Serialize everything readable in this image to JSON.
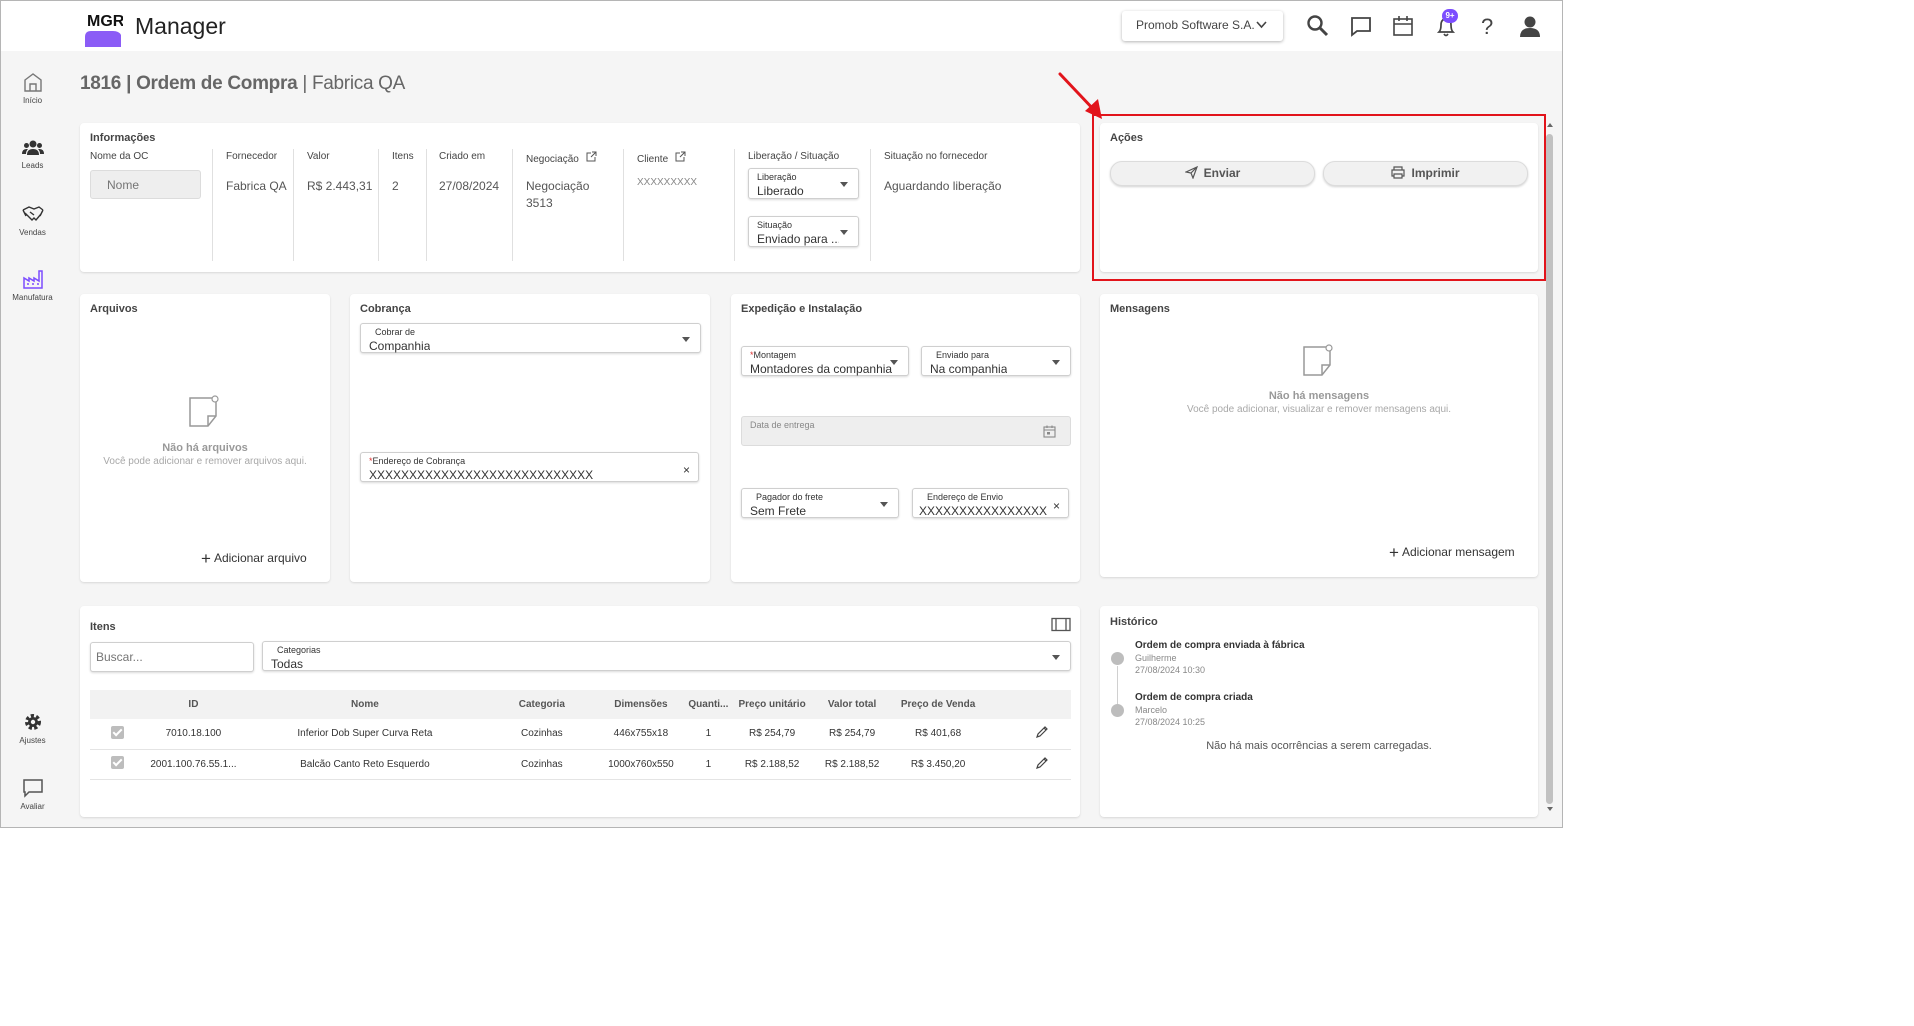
{
  "app": {
    "logo_text": "MGR",
    "title": "Manager"
  },
  "topbar": {
    "company": "Promob Software S.A.",
    "notification_badge": "9+"
  },
  "sidebar": {
    "items": [
      {
        "label": "Início",
        "icon": "home-icon"
      },
      {
        "label": "Leads",
        "icon": "people-icon"
      },
      {
        "label": "Vendas",
        "icon": "handshake-icon"
      },
      {
        "label": "Manufatura",
        "icon": "factory-icon"
      },
      {
        "label": "Ajustes",
        "icon": "gear-icon"
      },
      {
        "label": "Avaliar",
        "icon": "chat-icon"
      }
    ]
  },
  "page": {
    "number": "1816",
    "doc_type": "Ordem de Compra",
    "separator": "|",
    "subtitle": "Fabrica QA"
  },
  "info": {
    "title": "Informações",
    "oc_name_label": "Nome da OC",
    "oc_name_placeholder": "Nome",
    "fornecedor_label": "Fornecedor",
    "fornecedor": "Fabrica QA",
    "valor_label": "Valor",
    "valor": "R$ 2.443,31",
    "itens_label": "Itens",
    "itens": "2",
    "criado_label": "Criado em",
    "criado": "27/08/2024",
    "negociacao_label": "Negociação",
    "negociacao_l1": "Negociação",
    "negociacao_l2": "3513",
    "cliente_label": "Cliente",
    "cliente": "XXXXXXXXX",
    "liberacao_situacao_label": "Liberação / Situação",
    "liberacao_label": "Liberação",
    "liberacao": "Liberado",
    "situacao_label": "Situação",
    "situacao": "Enviado para ...",
    "situacao_fornecedor_label": "Situação no fornecedor",
    "situacao_fornecedor": "Aguardando liberação"
  },
  "acoes": {
    "title": "Ações",
    "send": "Enviar",
    "print": "Imprimir"
  },
  "arquivos": {
    "title": "Arquivos",
    "empty_title": "Não há arquivos",
    "empty_sub": "Você pode adicionar e remover arquivos aqui.",
    "add": "Adicionar arquivo"
  },
  "cobranca": {
    "title": "Cobrança",
    "cobrar_label": "Cobrar de",
    "cobrar": "Companhia",
    "endereco_label": "Endereço de Cobrança",
    "endereco": "XXXXXXXXXXXXXXXXXXXXXXXXXXXX"
  },
  "expedicao": {
    "title": "Expedição e Instalação",
    "montagem_label": "Montagem",
    "montagem": "Montadores da companhia",
    "enviado_label": "Enviado para",
    "enviado": "Na companhia",
    "data_label": "Data de entrega",
    "pagador_label": "Pagador do frete",
    "pagador": "Sem Frete",
    "envio_label": "Endereço de Envio",
    "envio": "XXXXXXXXXXXXXXXXX"
  },
  "mensagens": {
    "title": "Mensagens",
    "empty_title": "Não há mensagens",
    "empty_sub": "Você pode adicionar, visualizar e remover mensagens aqui.",
    "add": "Adicionar mensagem"
  },
  "itens": {
    "title": "Itens",
    "search_placeholder": "Buscar...",
    "categorias_label": "Categorias",
    "categorias": "Todas",
    "columns": [
      "ID",
      "Nome",
      "Categoria",
      "Dimensões",
      "Quanti...",
      "Preço unitário",
      "Valor total",
      "Preço de Venda"
    ],
    "rows": [
      {
        "id": "7010.18.100",
        "nome": "Inferior Dob Super Curva Reta",
        "categoria": "Cozinhas",
        "dimensoes": "446x755x18",
        "qtd": "1",
        "unit": "R$ 254,79",
        "total": "R$ 254,79",
        "venda": "R$ 401,68"
      },
      {
        "id": "2001.100.76.55.1...",
        "nome": "Balcão Canto Reto Esquerdo",
        "categoria": "Cozinhas",
        "dimensoes": "1000x760x550",
        "qtd": "1",
        "unit": "R$ 2.188,52",
        "total": "R$ 2.188,52",
        "venda": "R$ 3.450,20"
      }
    ]
  },
  "historico": {
    "title": "Histórico",
    "events": [
      {
        "title": "Ordem de compra enviada à fábrica",
        "user": "Guilherme",
        "date": "27/08/2024 10:30"
      },
      {
        "title": "Ordem de compra criada",
        "user": "Marcelo",
        "date": "27/08/2024 10:25"
      }
    ],
    "end_text": "Não há mais ocorrências a serem carregadas."
  },
  "colors": {
    "accent": "#7c4dff",
    "annotation": "#e2141b"
  }
}
